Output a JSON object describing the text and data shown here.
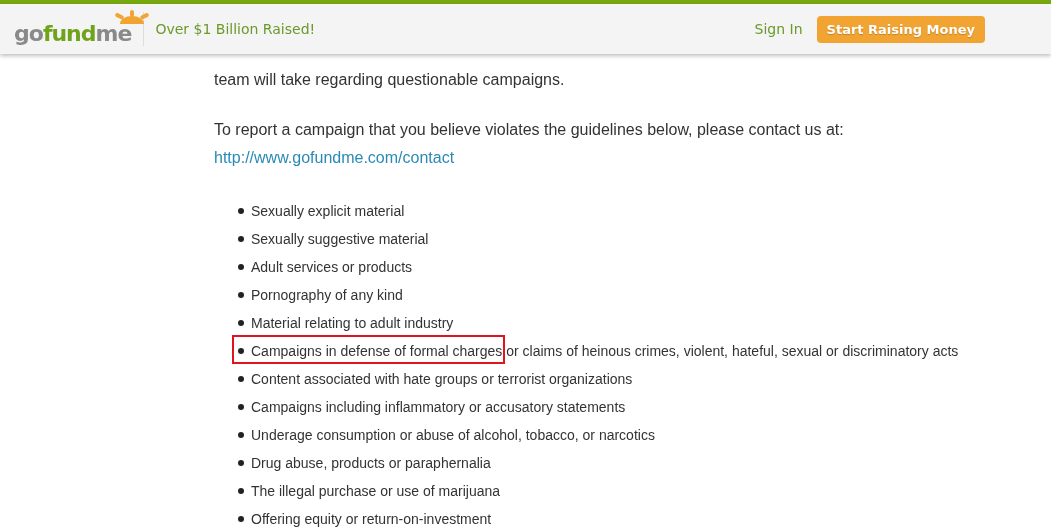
{
  "header": {
    "logo": {
      "parts": [
        "go",
        "fund",
        "me"
      ]
    },
    "tagline": "Over $1 Billion Raised!",
    "sign_in": "Sign In",
    "cta_button": "Start Raising Money"
  },
  "content": {
    "paragraphs": [
      {
        "kind": "text",
        "lines": [
          "team will take regarding questionable campaigns."
        ]
      },
      {
        "kind": "contact",
        "text": "To report a campaign that you believe violates the guidelines below, please contact us at:",
        "link": "http://www.gofundme.com/contact"
      }
    ],
    "list": [
      {
        "text": "Sexually explicit material",
        "highlighted": false
      },
      {
        "text": "Sexually suggestive material",
        "highlighted": false
      },
      {
        "text": "Adult services or products",
        "highlighted": false
      },
      {
        "text": "Pornography of any kind",
        "highlighted": false
      },
      {
        "text": "Material relating to adult industry",
        "highlighted": false
      },
      {
        "text": "Campaigns in defense of formal charges or claims of heinous crimes, violent, hateful, sexual or discriminatory acts",
        "highlighted": true
      },
      {
        "text": "Content associated with hate groups or terrorist organizations",
        "highlighted": false
      },
      {
        "text": "Campaigns including inflammatory or accusatory statements",
        "highlighted": false
      },
      {
        "text": "Underage consumption or abuse of alcohol, tobacco, or narcotics",
        "highlighted": false
      },
      {
        "text": "Drug abuse, products or paraphernalia",
        "highlighted": false
      },
      {
        "text": "The illegal purchase or use of marijuana",
        "highlighted": false
      },
      {
        "text": "Offering equity or return-on-investment",
        "highlighted": false
      }
    ]
  }
}
